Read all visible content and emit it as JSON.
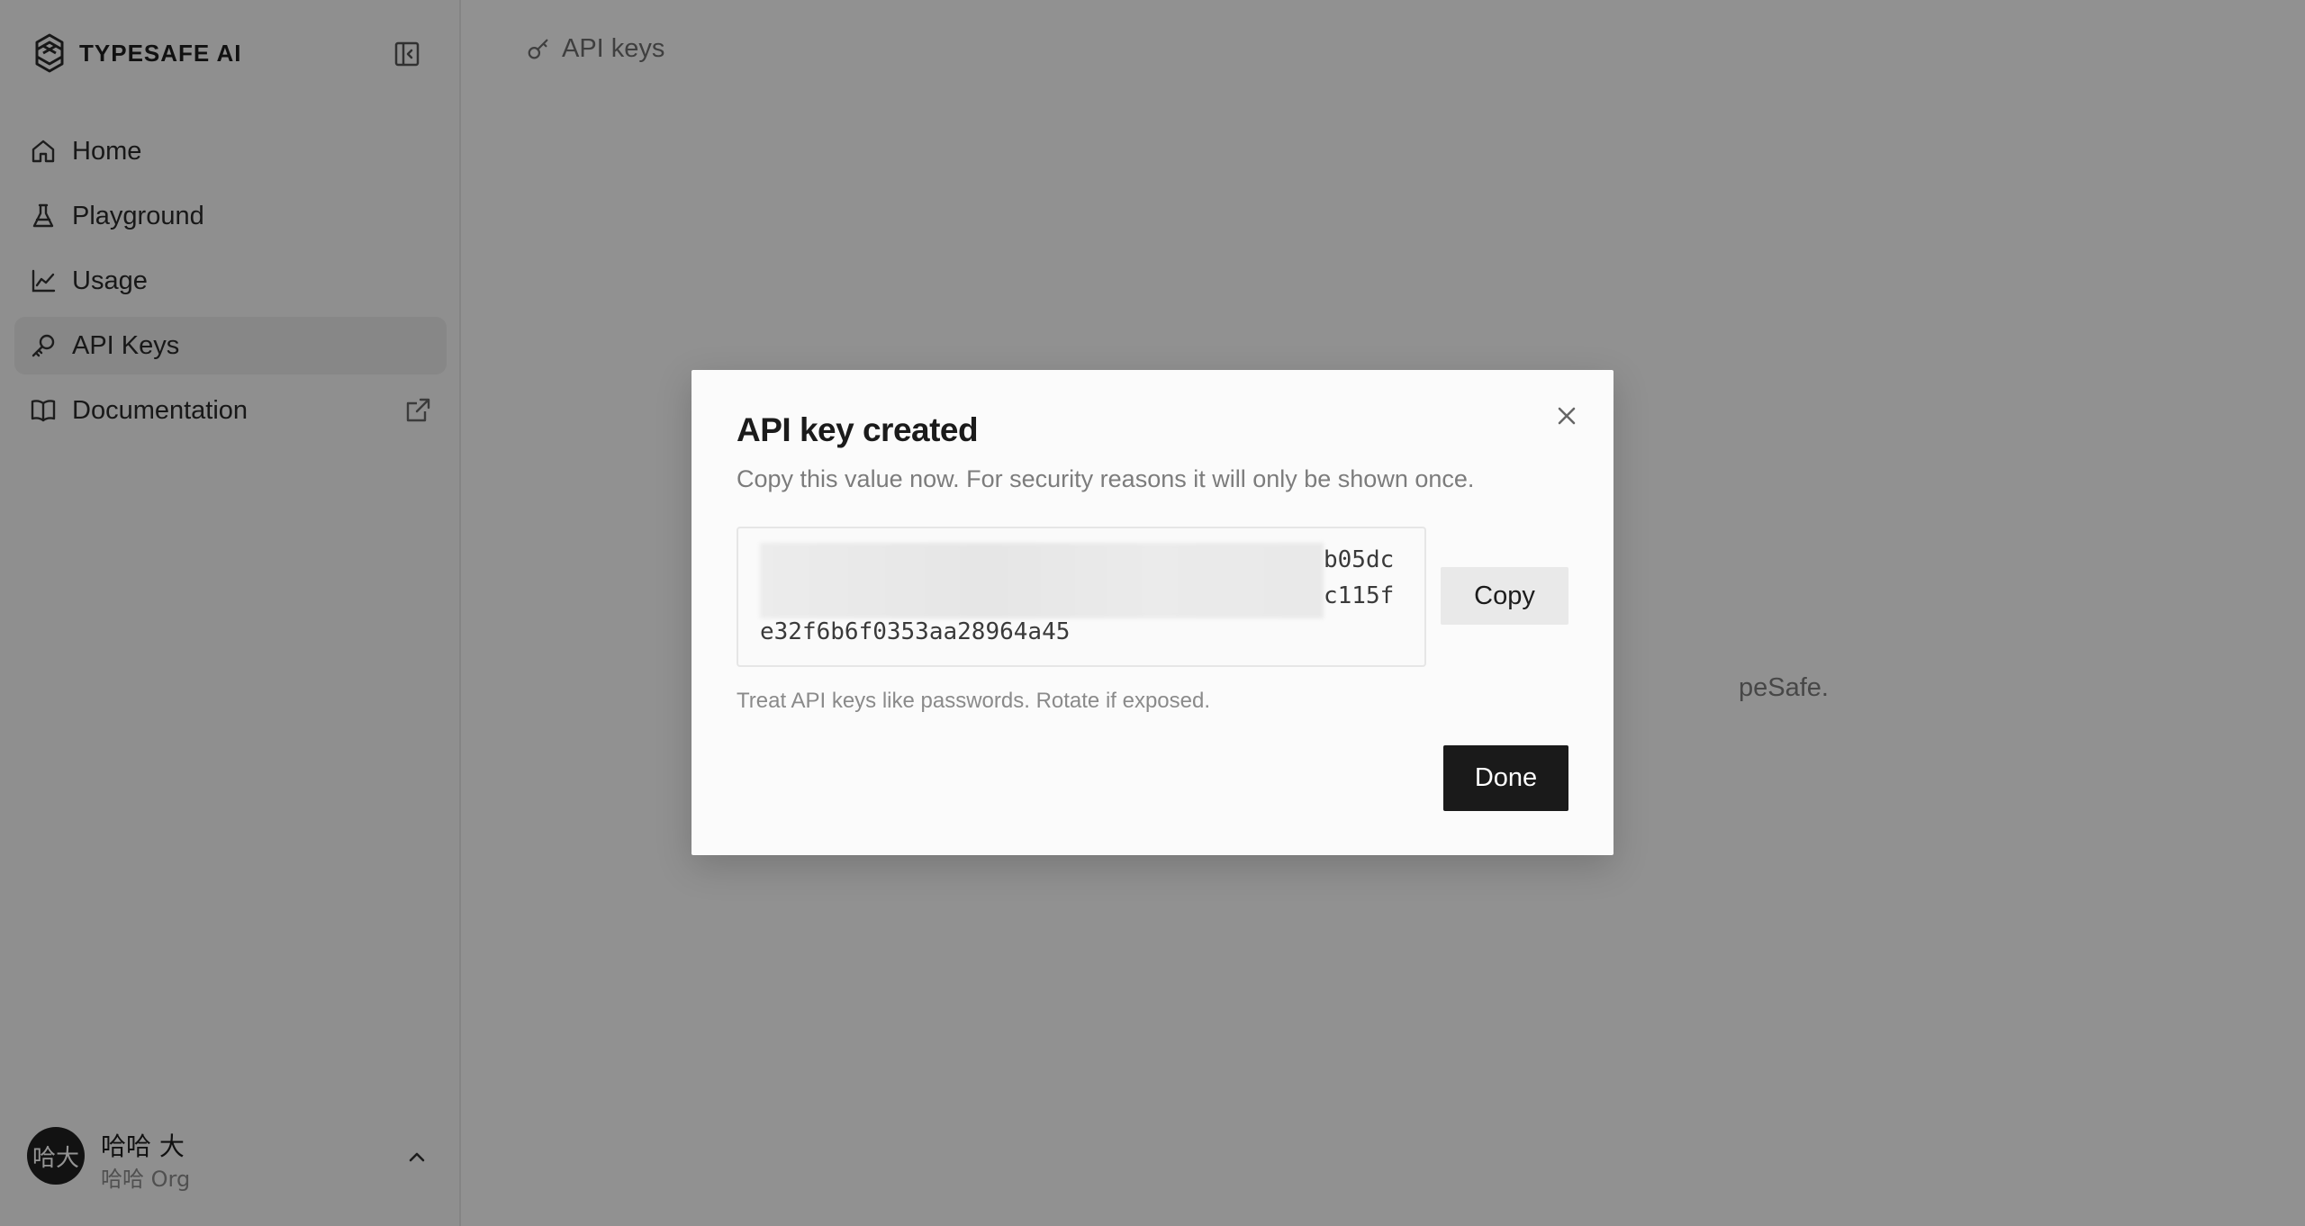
{
  "brand": {
    "name": "TYPESAFE AI"
  },
  "sidebar": {
    "items": [
      {
        "label": "Home",
        "icon": "home-icon",
        "active": false
      },
      {
        "label": "Playground",
        "icon": "flask-icon",
        "active": false
      },
      {
        "label": "Usage",
        "icon": "line-chart-icon",
        "active": false
      },
      {
        "label": "API Keys",
        "icon": "key-icon",
        "active": true
      },
      {
        "label": "Documentation",
        "icon": "book-icon",
        "active": false,
        "external": true
      }
    ]
  },
  "user": {
    "avatar_text": "哈大",
    "name": "哈哈 大",
    "org": "哈哈 Org"
  },
  "header": {
    "title": "API keys"
  },
  "background": {
    "partial_text": "peSafe."
  },
  "modal": {
    "title": "API key created",
    "description": "Copy this value now. For security reasons it will only be shown once.",
    "key_lines": [
      "b05dc",
      "c115f",
      "e32f6b6f0353aa28964a45"
    ],
    "copy_label": "Copy",
    "hint": "Treat API keys like passwords. Rotate if exposed.",
    "done_label": "Done"
  },
  "colors": {
    "overlay": "#000000",
    "primary_button": "#1a1a1a",
    "active_nav": "#e8e8e8"
  }
}
